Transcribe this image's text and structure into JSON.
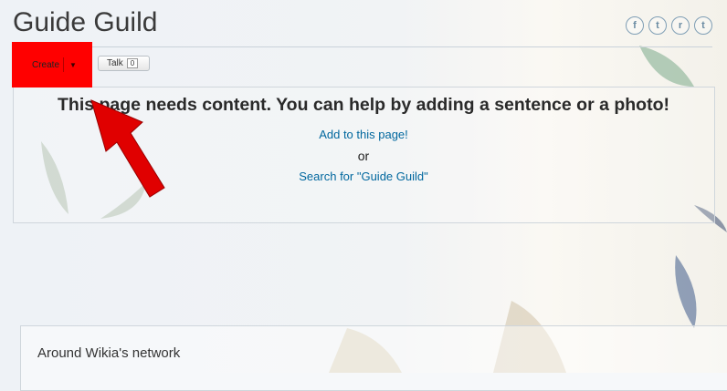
{
  "page": {
    "title": "Guide Guild"
  },
  "social": [
    {
      "icon": "facebook-icon",
      "glyph": "f"
    },
    {
      "icon": "twitter-icon",
      "glyph": "t"
    },
    {
      "icon": "reddit-icon",
      "glyph": "r"
    },
    {
      "icon": "tumblr-icon",
      "glyph": "t"
    }
  ],
  "toolbar": {
    "create_label": "Create",
    "create_menu_icon": "chevron-down-icon",
    "talk_label": "Talk",
    "talk_count": "0"
  },
  "empty_state": {
    "message": "This page needs content. You can help by adding a sentence or a photo!",
    "add_link": "Add to this page!",
    "or_text": "or",
    "search_link": "Search for \"Guide Guild\""
  },
  "network": {
    "heading": "Around Wikia's network"
  },
  "colors": {
    "highlight": "#ff0000",
    "link": "#00679e"
  }
}
